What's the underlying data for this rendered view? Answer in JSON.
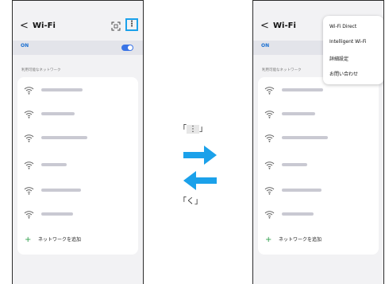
{
  "left_screen": {
    "header": {
      "back_glyph": "<",
      "title": "Wi-Fi",
      "more_glyph": "⋮"
    },
    "toggle": {
      "label": "ON",
      "state": "on"
    },
    "section_label": "利用可能なネットワーク",
    "networks_count_note": "names blurred",
    "add_network_label": "ネットワークを追加"
  },
  "right_screen": {
    "header": {
      "back_glyph": "<",
      "title": "Wi-Fi"
    },
    "toggle": {
      "label": "ON",
      "state": "on"
    },
    "section_label": "利用可能なネットワーク",
    "add_network_label": "ネットワークを追加",
    "menu": {
      "items": [
        "Wi-Fi Direct",
        "Intelligent Wi-Fi",
        "詳細設定",
        "お問い合わせ"
      ]
    }
  },
  "center": {
    "top_label": {
      "open": "「",
      "glyph": "⋮",
      "close": "」"
    },
    "bottom_label": {
      "open": "「",
      "glyph": "く",
      "close": "」"
    },
    "arrow_color": "#1ba1ea"
  },
  "colors": {
    "accent": "#1ba1ea",
    "toggle": "#3a74e6",
    "add_plus": "#2e9f4a"
  }
}
